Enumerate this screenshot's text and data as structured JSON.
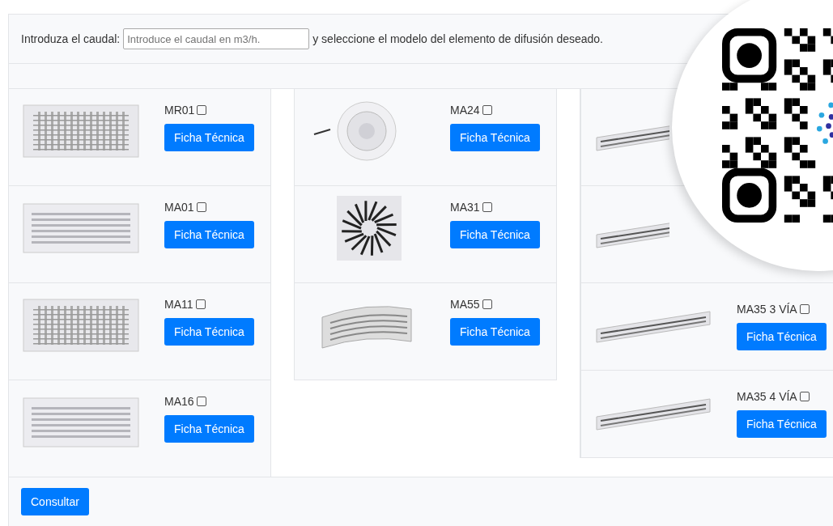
{
  "form": {
    "label": "Introduza el caudal:",
    "placeholder": "Introduce el caudal en m3/h.",
    "suffix": "y seleccione el modelo del elemento de difusión deseado."
  },
  "columns": [
    {
      "products": [
        {
          "kind": "grille",
          "label": "MR01",
          "checked": false,
          "button": "Ficha Técnica"
        },
        {
          "kind": "bars",
          "label": "MA01",
          "checked": false,
          "button": "Ficha Técnica"
        },
        {
          "kind": "grille",
          "label": "MA11",
          "checked": false,
          "button": "Ficha Técnica"
        },
        {
          "kind": "bars",
          "label": "MA16",
          "checked": false,
          "button": "Ficha Técnica"
        }
      ]
    },
    {
      "products": [
        {
          "kind": "round",
          "label": "MA24",
          "checked": false,
          "button": "Ficha Técnica"
        },
        {
          "kind": "swirl",
          "label": "MA31",
          "checked": false,
          "button": "Ficha Técnica"
        },
        {
          "kind": "curved",
          "label": "MA55",
          "checked": false,
          "button": "Ficha Técnica"
        }
      ]
    },
    {
      "products": [
        {
          "kind": "slot"
        },
        {
          "kind": "slot"
        },
        {
          "kind": "slot",
          "label": "MA35 3 VÍA",
          "checked": false,
          "button": "Ficha Técnica"
        },
        {
          "kind": "slot",
          "label": "MA35 4 VÍA",
          "checked": false,
          "button": "Ficha Técnica"
        }
      ]
    }
  ],
  "submit": "Consultar"
}
